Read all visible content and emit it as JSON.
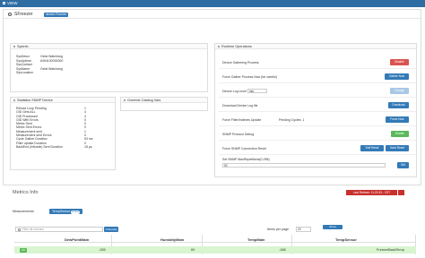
{
  "topbar": {
    "title": "VIEW"
  },
  "header": {
    "title": "SFreezer",
    "tag": "device.Freezer"
  },
  "sysinfo": {
    "title": "SysInfo",
    "rows": [
      {
        "k": "SysDescr",
        "v": "Geist Watchdog"
      },
      {
        "k": "SysUptime",
        "v": "6494100000000"
      },
      {
        "k": "SysContact",
        "v": ""
      },
      {
        "k": "SysName",
        "v": "Geist Watchdog"
      },
      {
        "k": "SysLocation",
        "v": ""
      }
    ]
  },
  "stats": {
    "title": "Statistics SNMP Device",
    "rows": [
      {
        "k": "Reload Loop Pending",
        "v": "1"
      },
      {
        "k": "OID Gets ALL",
        "v": "4"
      },
      {
        "k": "OID Processed",
        "v": "4"
      },
      {
        "k": "OID With Errors",
        "v": "0"
      },
      {
        "k": "Metric Sent",
        "v": "0"
      },
      {
        "k": "Metric Sent Errors",
        "v": "0"
      },
      {
        "k": "Measurement sent",
        "v": "1"
      },
      {
        "k": "Measurement sent Errors",
        "v": "0"
      },
      {
        "k": "Cycle Gather Duration",
        "v": "53 ms"
      },
      {
        "k": "Filter update Duration",
        "v": "0"
      },
      {
        "k": "BackEnd (influxdb) Sent Duration",
        "v": "18 µs"
      }
    ]
  },
  "catalog": {
    "title": "Override Catalog Vars"
  },
  "runtime": {
    "title": "Runtime Operations",
    "rows": [
      {
        "label": "Device Gathering Process",
        "btn": "Disable"
      },
      {
        "label": "Force Gather Process Now (be careful)",
        "btn": "Gather Now"
      },
      {
        "label": "Device Log Level",
        "select": "info",
        "btn": "Change"
      },
      {
        "label": "Download Device Log file",
        "btn": "Download"
      },
      {
        "label": "Force Filter/Indexes Update",
        "extra": "Pending Cycles: 1",
        "btn": "Force Now"
      },
      {
        "label": "SNMP Protocol Debug",
        "btn": "Enable"
      },
      {
        "label": "Force SNMP Connection Reset",
        "btn": "Soft Reset",
        "btn2": "Hard Reset"
      },
      {
        "label": "Set SNMP MaxRepetitions(0-255)",
        "input": "50",
        "btn": "Set"
      }
    ]
  },
  "metrics": {
    "title": "Metrics Info",
    "last_refresh": "Last Refresh: 11:23:33 - CST",
    "tab_measurements": "Measurements",
    "tab_temp": "TempSensor",
    "tab_badge": "Active",
    "filter_placeholder": "Filter all columns",
    "filter_btn": "0 Results",
    "items_label": "Items per page",
    "items_value": "20",
    "show_btn": "Show Timestamp",
    "columns": [
      "DewPointMain",
      "HumidityMain",
      "TempMain",
      "TempSensor"
    ],
    "row": {
      "badge": "OK",
      "v1": "-155",
      "v2": "69",
      "v3": "-188",
      "v4": "FreezerBackTemp"
    }
  }
}
